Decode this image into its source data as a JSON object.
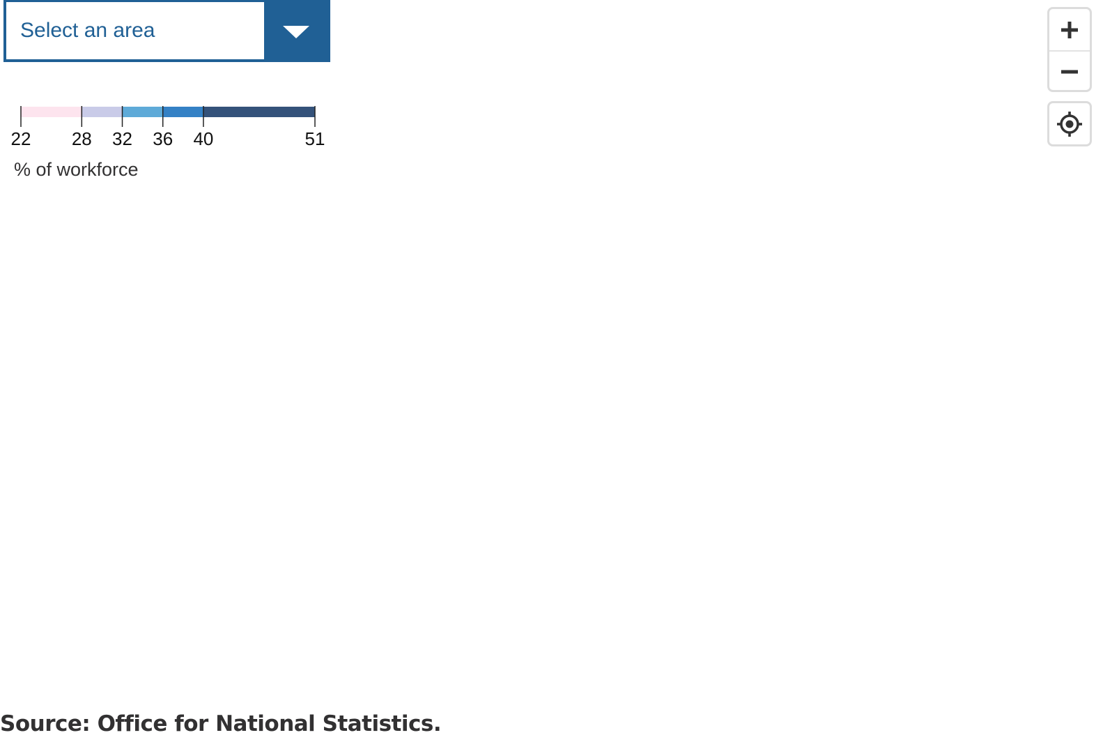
{
  "area_select": {
    "placeholder": "Select an area",
    "toggle_icon": "chevron-down-icon"
  },
  "legend": {
    "breaks": [
      22,
      28,
      32,
      36,
      40,
      51
    ],
    "colors": [
      "#fde4ee",
      "#c9cbe8",
      "#5eaad8",
      "#3481c5",
      "#34527a"
    ],
    "tick_labels": [
      "22",
      "28",
      "32",
      "36",
      "40",
      "51"
    ],
    "unit_label": "% of workforce"
  },
  "map_controls": {
    "zoom_in_icon": "plus-icon",
    "zoom_out_icon": "minus-icon",
    "locate_icon": "crosshair-icon"
  },
  "footer": {
    "source": "Source: Office for National Statistics."
  },
  "colors": {
    "accent": "#206095",
    "text": "#323132"
  }
}
